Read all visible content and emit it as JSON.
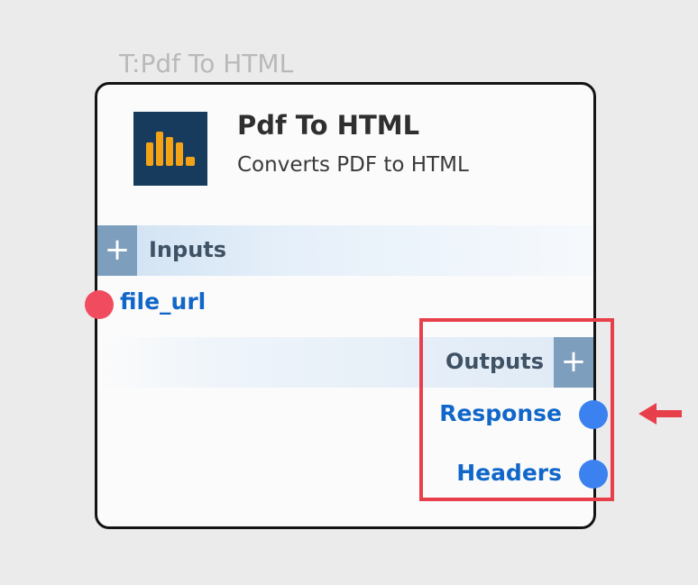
{
  "node": {
    "tag": "T:Pdf To HTML",
    "title": "Pdf To HTML",
    "description": "Converts PDF to HTML",
    "logo_icon": "bar-chart-logo-icon"
  },
  "inputs": {
    "section_label": "Inputs",
    "add_symbol": "+",
    "ports": [
      {
        "label": "file_url"
      }
    ]
  },
  "outputs": {
    "section_label": "Outputs",
    "add_symbol": "+",
    "ports": [
      {
        "label": "Response"
      },
      {
        "label": "Headers"
      }
    ]
  },
  "colors": {
    "canvas_bg": "#ebebeb",
    "logo_bg": "#173b5c",
    "logo_bars": "#f5a316",
    "input_port": "#f04b5f",
    "output_port": "#3b82f0",
    "port_label": "#1167c9",
    "highlight": "#e8404b"
  }
}
